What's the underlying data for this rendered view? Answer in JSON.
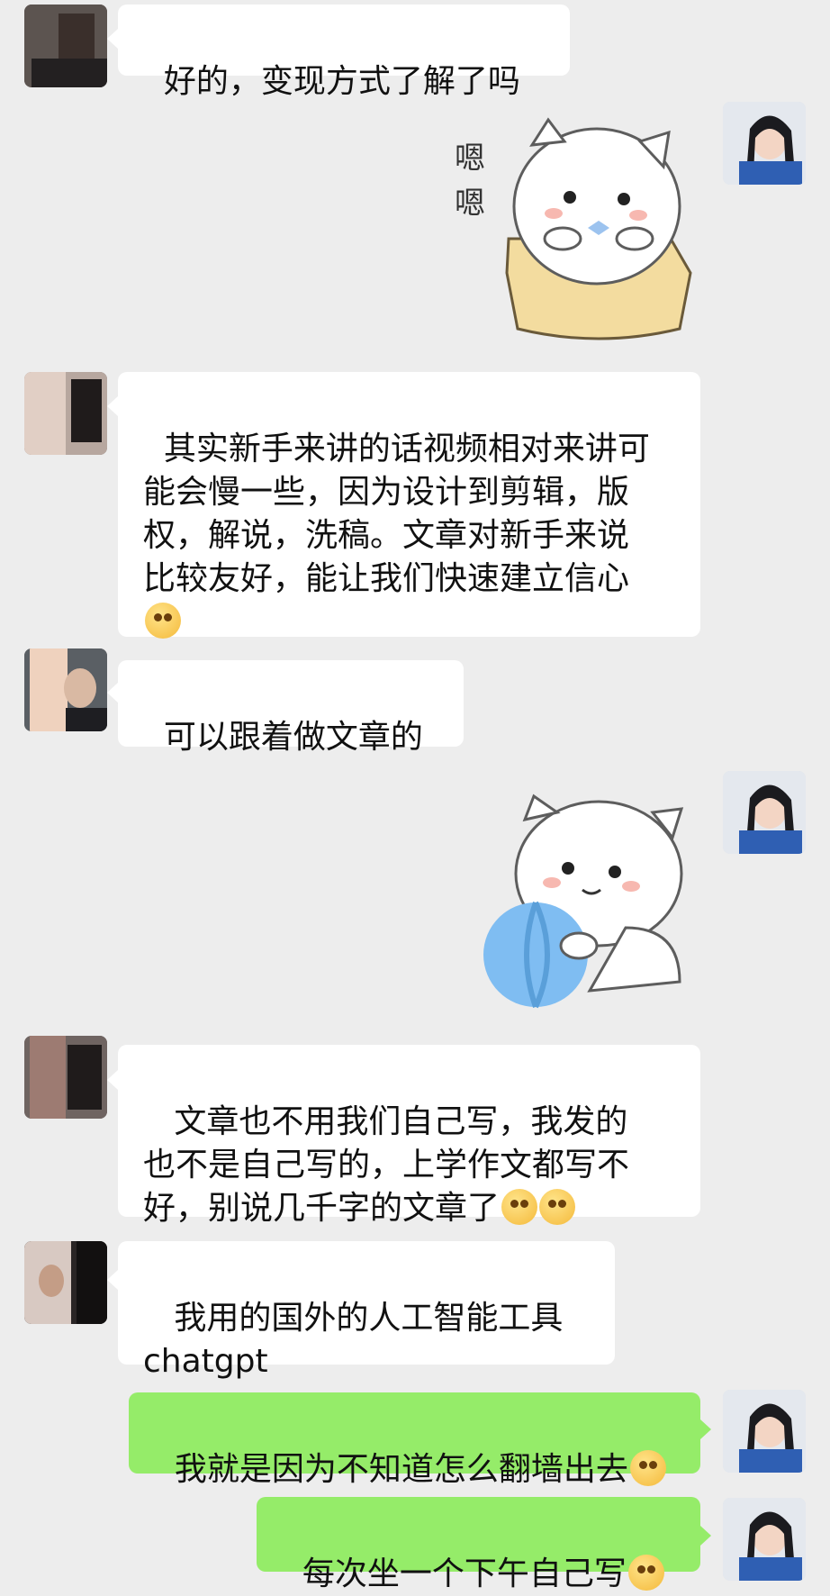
{
  "messages": [
    {
      "side": "left",
      "text": "好的，变现方式了解了吗"
    },
    {
      "side": "right",
      "sticker": "cat-in-box-sticker",
      "sticker_text": "嗯\n嗯"
    },
    {
      "side": "left",
      "text": "其实新手来讲的话视频相对来讲可\n能会慢一些，因为设计到剪辑，版\n权，解说，洗稿。文章对新手来说\n比较友好，能让我们快速建立信心",
      "emoji": "thinking-face-emoji"
    },
    {
      "side": "left",
      "text": "可以跟着做文章的"
    },
    {
      "side": "right",
      "sticker": "cat-with-ball-sticker"
    },
    {
      "side": "left",
      "text": " 文章也不用我们自己写，我发的\n也不是自己写的，上学作文都写不\n好，别说几千字的文章了",
      "emoji": "crying-face-emoji"
    },
    {
      "side": "left",
      "text": " 我用的国外的人工智能工具\nchatgpt"
    },
    {
      "side": "right",
      "text": "我就是因为不知道怎么翻墙出去",
      "emoji": "crying-face-emoji"
    },
    {
      "side": "right",
      "text": "每次坐一个下午自己写",
      "emoji": "crying-face-emoji"
    }
  ],
  "colors": {
    "background": "#ededed",
    "incoming_bubble": "#ffffff",
    "outgoing_bubble": "#95ec69"
  }
}
